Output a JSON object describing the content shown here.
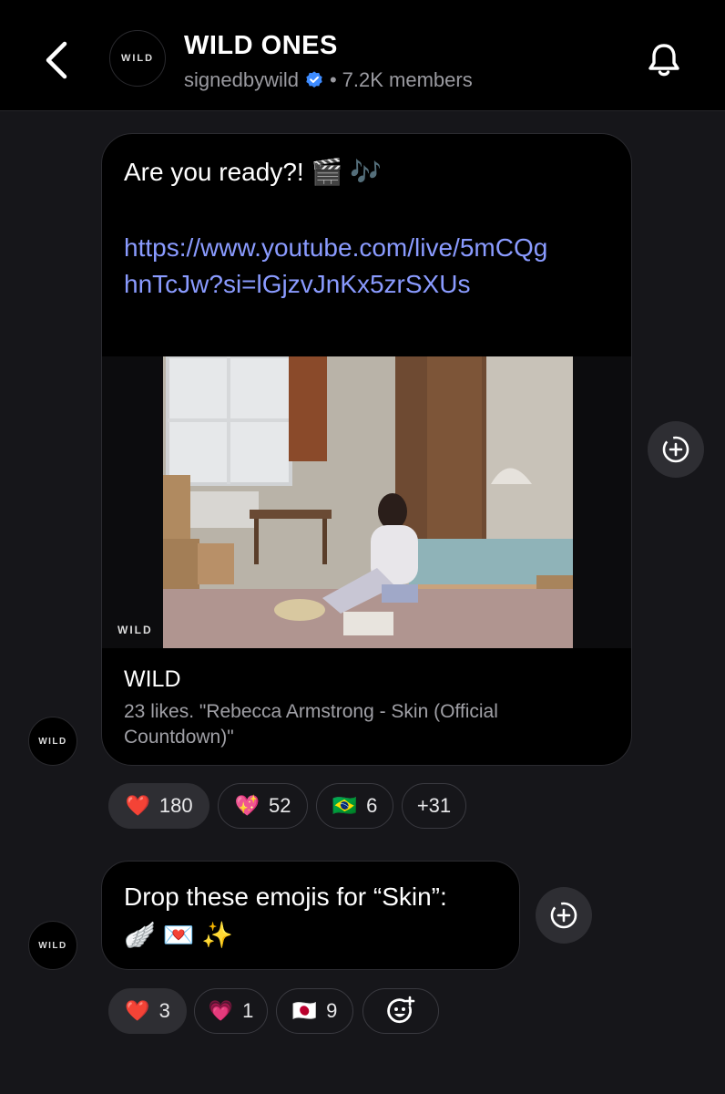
{
  "header": {
    "avatar_text": "WILD",
    "title": "WILD ONES",
    "handle": "signedbywild",
    "separator": "•",
    "members": "7.2K members"
  },
  "message1": {
    "text": "Are you ready?! 🎬 🎶",
    "link": "https://www.youtube.com/live/5mCQghnTcJw?si=lGjzvJnKx5zrSXUs",
    "preview": {
      "watermark": "WILD",
      "source": "WILD",
      "description": "23 likes. \"Rebecca Armstrong - Skin (Official Countdown)\""
    },
    "avatar_text": "WILD",
    "reactions": [
      {
        "emoji": "❤️",
        "count": "180",
        "active": true
      },
      {
        "emoji": "💖",
        "count": "52",
        "active": false
      },
      {
        "emoji": "🇧🇷",
        "count": "6",
        "active": false
      },
      {
        "emoji": "",
        "count": "+31",
        "active": false
      }
    ]
  },
  "message2": {
    "text_line1": "Drop these emojis for “Skin”:",
    "text_line2": "🪽 💌 ✨",
    "avatar_text": "WILD",
    "reactions": [
      {
        "emoji": "❤️",
        "count": "3",
        "active": true
      },
      {
        "emoji": "💗",
        "count": "1",
        "active": false
      },
      {
        "emoji": "🇯🇵",
        "count": "9",
        "active": false
      }
    ]
  },
  "icons": {
    "back": "chevron-left-icon",
    "bell": "bell-icon",
    "verified": "verified-badge-icon",
    "add_reaction": "add-reaction-icon",
    "emoji_add": "emoji-add-icon"
  },
  "colors": {
    "background": "#16161a",
    "link": "#8a9bff",
    "verified": "#3d8bff"
  }
}
